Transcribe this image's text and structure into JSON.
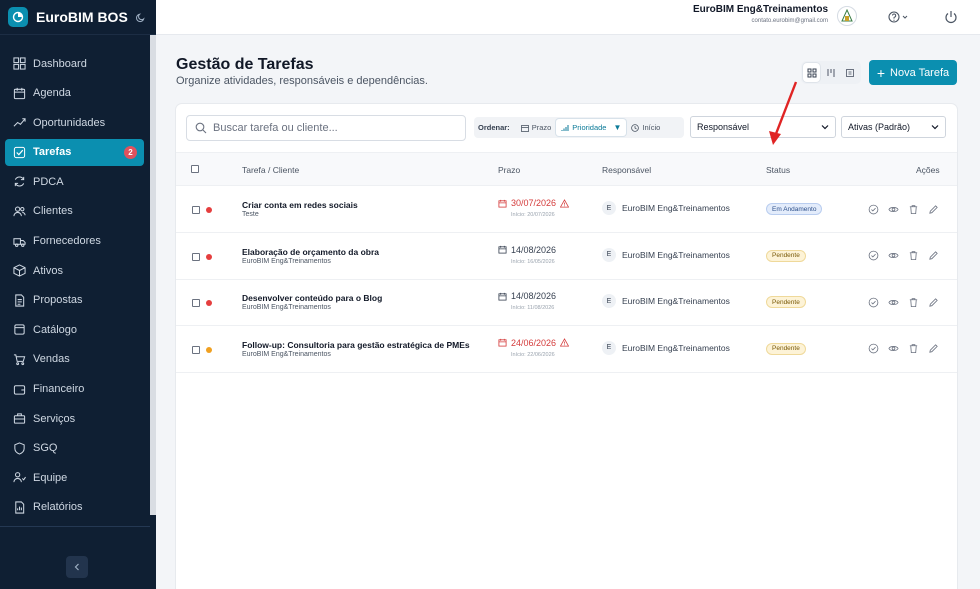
{
  "app": {
    "name": "EuroBIM BOS"
  },
  "sidebar": {
    "items": [
      {
        "label": "Dashboard",
        "icon": "dashboard-icon"
      },
      {
        "label": "Agenda",
        "icon": "calendar-icon"
      },
      {
        "label": "Oportunidades",
        "icon": "trend-icon"
      },
      {
        "label": "Tarefas",
        "icon": "task-check-icon",
        "active": true,
        "badge": "2"
      },
      {
        "label": "PDCA",
        "icon": "cycle-icon"
      },
      {
        "label": "Clientes",
        "icon": "users-icon"
      },
      {
        "label": "Fornecedores",
        "icon": "truck-icon"
      },
      {
        "label": "Ativos",
        "icon": "box-icon"
      },
      {
        "label": "Propostas",
        "icon": "document-icon"
      },
      {
        "label": "Catálogo",
        "icon": "catalog-icon"
      },
      {
        "label": "Vendas",
        "icon": "cart-icon"
      },
      {
        "label": "Financeiro",
        "icon": "wallet-icon"
      },
      {
        "label": "Serviços",
        "icon": "briefcase-icon"
      },
      {
        "label": "SGQ",
        "icon": "quality-icon"
      },
      {
        "label": "Equipe",
        "icon": "team-icon"
      },
      {
        "label": "Relatórios",
        "icon": "report-icon"
      }
    ]
  },
  "header": {
    "user_name": "EuroBIM Eng&Treinamentos",
    "user_email": "contato.eurobim@gmail.com"
  },
  "page": {
    "title": "Gestão de Tarefas",
    "subtitle": "Organize atividades, responsáveis e dependências.",
    "new_task_label": "Nova Tarefa"
  },
  "filters": {
    "search_placeholder": "Buscar tarefa ou cliente...",
    "sort_label": "Ordenar:",
    "sort_options": [
      "Prazo",
      "Prioridade",
      "Início"
    ],
    "sort_active": "Prioridade",
    "sort_active_marker": "▼",
    "responsavel": "Responsável",
    "status_filter": "Ativas (Padrão)"
  },
  "table": {
    "headers": {
      "task": "Tarefa / Cliente",
      "due": "Prazo",
      "owner": "Responsável",
      "status": "Status",
      "actions": "Ações"
    },
    "rows": [
      {
        "title": "Criar conta em redes sociais",
        "client": "Teste",
        "due": "30/07/2026",
        "late": true,
        "start": "Início: 20/07/2026",
        "owner_initial": "E",
        "owner": "EuroBIM Eng&Treinamentos",
        "status": "Em Andamento",
        "priority_color": "#e53e3e"
      },
      {
        "title": "Elaboração de orçamento da obra",
        "client": "EuroBIM Eng&Treinamentos",
        "due": "14/08/2026",
        "late": false,
        "start": "Início: 16/05/2026",
        "owner_initial": "E",
        "owner": "EuroBIM Eng&Treinamentos",
        "status": "Pendente",
        "priority_color": "#e53e3e"
      },
      {
        "title": "Desenvolver conteúdo para o Blog",
        "client": "EuroBIM Eng&Treinamentos",
        "due": "14/08/2026",
        "late": false,
        "start": "Início: 11/08/2026",
        "owner_initial": "E",
        "owner": "EuroBIM Eng&Treinamentos",
        "status": "Pendente",
        "priority_color": "#e53e3e"
      },
      {
        "title": "Follow-up: Consultoria para gestão estratégica de PMEs",
        "client": "EuroBIM Eng&Treinamentos",
        "due": "24/06/2026",
        "late": true,
        "start": "Início: 22/06/2026",
        "owner_initial": "E",
        "owner": "EuroBIM Eng&Treinamentos",
        "status": "Pendente",
        "priority_color": "#f0a020"
      }
    ]
  },
  "colors": {
    "accent": "#0b8fb0",
    "sidebar_bg": "#0f1f33",
    "late": "#d43b3b",
    "annotation_arrow": "#e02424"
  }
}
